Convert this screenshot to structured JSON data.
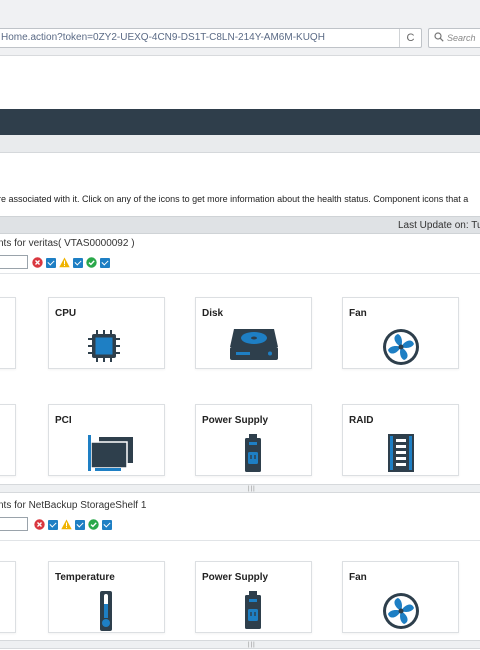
{
  "browser": {
    "url": "Home.action?token=0ZY2-UEXQ-4CN9-DS1T-C8LN-214Y-AM6M-KUQH",
    "search_placeholder": "Search",
    "reload_glyph": "C"
  },
  "info_text": "re associated with it. Click on any of the icons to get more information about the health status. Component icons that a",
  "last_update": "Last Update on: Tu",
  "sections": [
    {
      "title": "nts for veritas( VTAS0000092 )",
      "cards_row1": [
        {
          "label": "CPU",
          "icon": "cpu-icon"
        },
        {
          "label": "Disk",
          "icon": "disk-icon"
        },
        {
          "label": "Fan",
          "icon": "fan-icon"
        }
      ],
      "cards_row2": [
        {
          "label": "PCI",
          "icon": "pci-icon"
        },
        {
          "label": "Power Supply",
          "icon": "power-supply-icon"
        },
        {
          "label": "RAID",
          "icon": "raid-icon"
        }
      ]
    },
    {
      "title": "nts for NetBackup StorageShelf 1",
      "cards_row1": [
        {
          "label": "Temperature",
          "icon": "temperature-icon"
        },
        {
          "label": "Power Supply",
          "icon": "power-supply-icon"
        },
        {
          "label": "Fan",
          "icon": "fan-icon"
        }
      ]
    }
  ],
  "splitter_glyph": "|||",
  "colors": {
    "header_dark": "#2f3e4b",
    "icon_dark": "#2e3f4c",
    "icon_blue": "#1e7fc4",
    "error_red": "#d9373f",
    "warning_yellow": "#f0b400",
    "ok_green": "#2aa84a"
  }
}
